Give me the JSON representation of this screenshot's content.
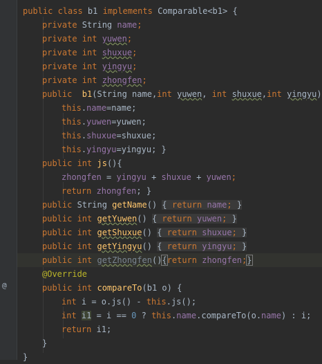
{
  "gutter": {
    "override_marker": "@"
  },
  "lines": [
    {
      "kind": "class_decl",
      "t": [
        "public class ",
        "b1",
        " implements ",
        "Comparable<b1>",
        " {"
      ]
    },
    {
      "kind": "field",
      "t": [
        "private ",
        "String ",
        "name",
        ";"
      ]
    },
    {
      "kind": "field",
      "t": [
        "private ",
        "int ",
        "yuwen",
        ";"
      ]
    },
    {
      "kind": "field",
      "t": [
        "private ",
        "int ",
        "shuxue",
        ";"
      ]
    },
    {
      "kind": "field",
      "t": [
        "private ",
        "int ",
        "yingyu",
        ";"
      ]
    },
    {
      "kind": "field",
      "t": [
        "private ",
        "int ",
        "zhongfen",
        ";"
      ]
    },
    {
      "kind": "ctor",
      "t": [
        "public  ",
        "b1",
        "(String name,",
        "int ",
        "yuwen",
        ", ",
        "int ",
        "shuxue",
        ",",
        "int ",
        "yingyu",
        "){"
      ]
    },
    {
      "kind": "assign",
      "t": [
        "this",
        ".",
        "name",
        "=name;"
      ]
    },
    {
      "kind": "assign",
      "t": [
        "this",
        ".",
        "yuwen",
        "=yuwen;"
      ]
    },
    {
      "kind": "assign",
      "t": [
        "this",
        ".",
        "shuxue",
        "=shuxue;"
      ]
    },
    {
      "kind": "assign",
      "t": [
        "this",
        ".",
        "yingyu",
        "=yingyu; }"
      ]
    },
    {
      "kind": "method",
      "t": [
        "public ",
        "int ",
        "js",
        "(){"
      ]
    },
    {
      "kind": "stmt",
      "t": [
        "zhongfen",
        " = ",
        "yingyu",
        " + ",
        "shuxue",
        " + ",
        "yuwen",
        ";"
      ]
    },
    {
      "kind": "ret",
      "t": [
        "return ",
        "zhongfen",
        "; }"
      ]
    },
    {
      "kind": "getter",
      "t": [
        "public ",
        "String ",
        "getName",
        "() ",
        "{ ",
        "return ",
        "name",
        "; ",
        "}"
      ]
    },
    {
      "kind": "getter",
      "t": [
        "public ",
        "int ",
        "getYuwen",
        "() ",
        "{ ",
        "return ",
        "yuwen",
        "; ",
        "}"
      ]
    },
    {
      "kind": "getter",
      "t": [
        "public ",
        "int ",
        "getShuxue",
        "() ",
        "{ ",
        "return ",
        "shuxue",
        "; ",
        "}"
      ]
    },
    {
      "kind": "getter",
      "t": [
        "public ",
        "int ",
        "getYingyu",
        "() ",
        "{ ",
        "return ",
        "yingyu",
        "; ",
        "}"
      ]
    },
    {
      "kind": "getter_cur",
      "t": [
        "public ",
        "int ",
        "getZhongfen",
        "()",
        "{",
        "return ",
        "zhongfen",
        ";",
        "}"
      ]
    },
    {
      "kind": "annotation",
      "t": [
        "@Override"
      ]
    },
    {
      "kind": "method2",
      "t": [
        "public ",
        "int ",
        "compareTo",
        "(b1 o) {"
      ]
    },
    {
      "kind": "stmt2",
      "t": [
        "int ",
        "i = o.js() - ",
        "this",
        ".js();"
      ]
    },
    {
      "kind": "stmt3",
      "t": [
        "int ",
        "i1",
        " = i == ",
        "0",
        " ? ",
        "this",
        ".",
        "name",
        ".compareTo(o.",
        "name",
        ") : i;"
      ]
    },
    {
      "kind": "ret2",
      "t": [
        "return ",
        "i1;"
      ]
    },
    {
      "kind": "close",
      "t": [
        "}"
      ]
    },
    {
      "kind": "close",
      "t": [
        "}"
      ]
    }
  ]
}
